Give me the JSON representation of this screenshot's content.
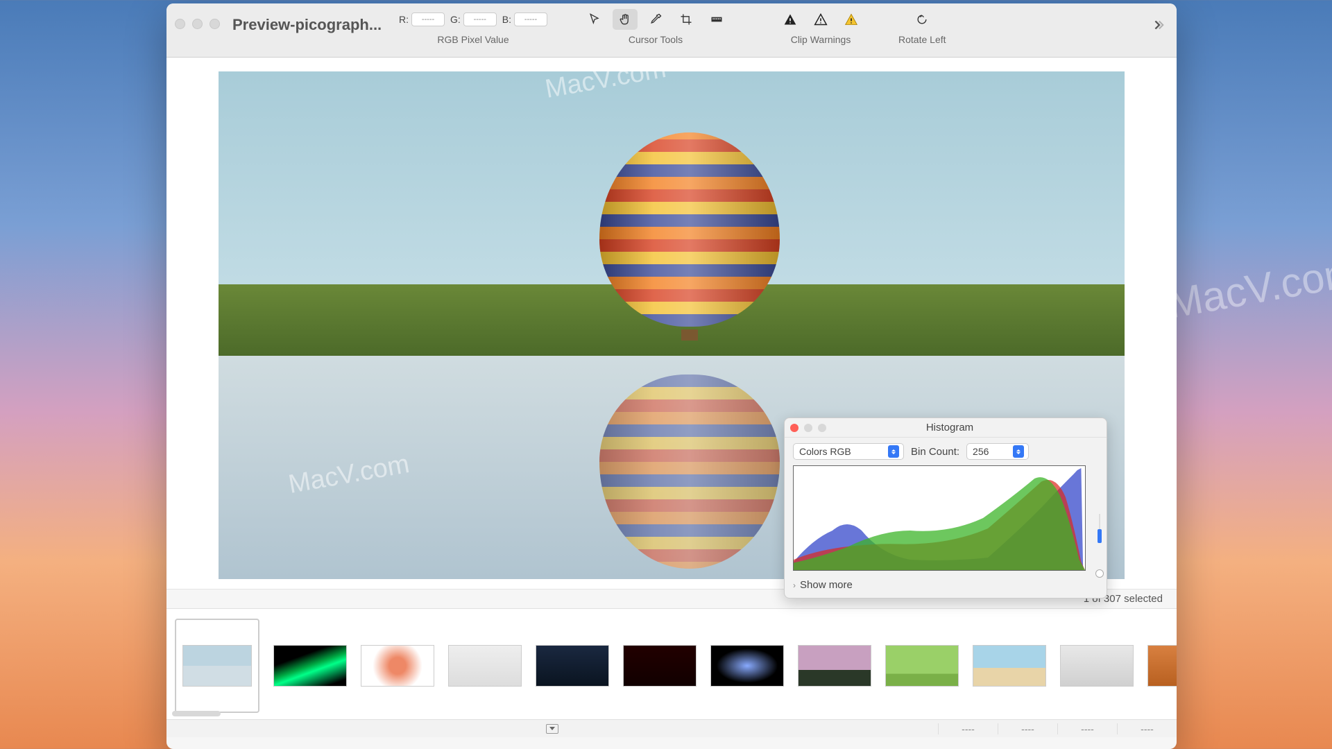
{
  "window": {
    "title": "Preview-picograph..."
  },
  "toolbar": {
    "rgb": {
      "r_label": "R:",
      "g_label": "G:",
      "b_label": "B:",
      "r_value": "-----",
      "g_value": "-----",
      "b_value": "-----",
      "group_label": "RGB Pixel Value"
    },
    "cursor_group_label": "Cursor Tools",
    "clip_group_label": "Clip Warnings",
    "rotate_label": "Rotate Left"
  },
  "histogram": {
    "title": "Histogram",
    "mode": "Colors RGB",
    "bin_label": "Bin Count:",
    "bin_value": "256",
    "show_more": "Show more"
  },
  "selection": {
    "text": "1 of 307 selected"
  },
  "status": {
    "c1": "----",
    "c2": "----",
    "c3": "----",
    "c4": "----"
  },
  "thumbs": [
    {
      "bg": "linear-gradient(#bcd4e0 50%, #d0dde4 50%)"
    },
    {
      "bg": "linear-gradient(160deg,#000 30%,#0a4 50%,#0f8 60%,#000 90%)"
    },
    {
      "bg": "radial-gradient(circle at 50% 50%, #e86 20%, #fff 60%)"
    },
    {
      "bg": "linear-gradient(#eee,#ddd)"
    },
    {
      "bg": "linear-gradient(#1a2840,#0a1420)"
    },
    {
      "bg": "linear-gradient(#200,#100)"
    },
    {
      "bg": "radial-gradient(ellipse at 50% 50%, #8af 0%, #000 60%)"
    },
    {
      "bg": "linear-gradient(#c8a0c0 60%,#2a3828 60%)"
    },
    {
      "bg": "linear-gradient(#9ad068 70%,#7ab048 70%)"
    },
    {
      "bg": "linear-gradient(#a8d4e8 55%,#e8d4a8 55%)"
    },
    {
      "bg": "linear-gradient(#e8e8e8,#d0d0d0)"
    },
    {
      "bg": "linear-gradient(#d88040,#b86020)"
    }
  ],
  "watermark": "MacV.com"
}
